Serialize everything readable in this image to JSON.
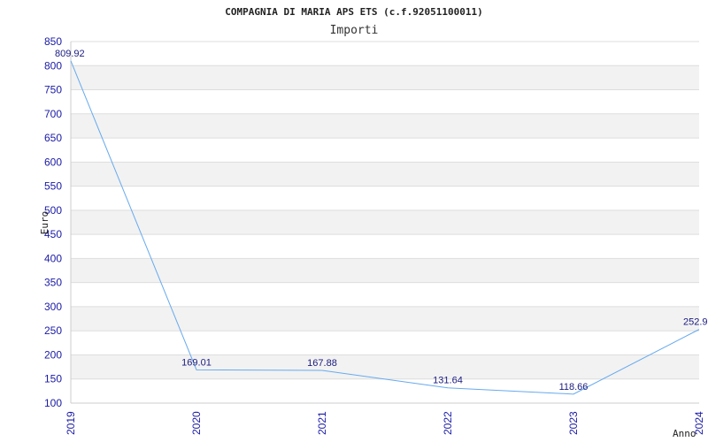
{
  "chart_data": {
    "type": "line",
    "title": "COMPAGNIA DI MARIA APS ETS (c.f.92051100011)",
    "subtitle": "Importi",
    "xlabel": "Anno",
    "ylabel": "Euro",
    "categories": [
      "2019",
      "2020",
      "2021",
      "2022",
      "2023",
      "2024"
    ],
    "series": [
      {
        "values": [
          809.92,
          169.01,
          167.88,
          131.64,
          118.66,
          252.9
        ],
        "labels": [
          "809.92",
          "169.01",
          "167.88",
          "131.64",
          "118.66",
          "252.9"
        ]
      }
    ],
    "ylim": [
      100,
      850
    ],
    "yticks": [
      "100",
      "150",
      "200",
      "250",
      "300",
      "350",
      "400",
      "450",
      "500",
      "550",
      "600",
      "650",
      "700",
      "750",
      "800",
      "850"
    ],
    "grid": true,
    "colors": {
      "line": "#66aaee",
      "band": "#f2f2f2",
      "tick_text": "#1a1aa6",
      "label_text": "#1a1a80"
    }
  }
}
